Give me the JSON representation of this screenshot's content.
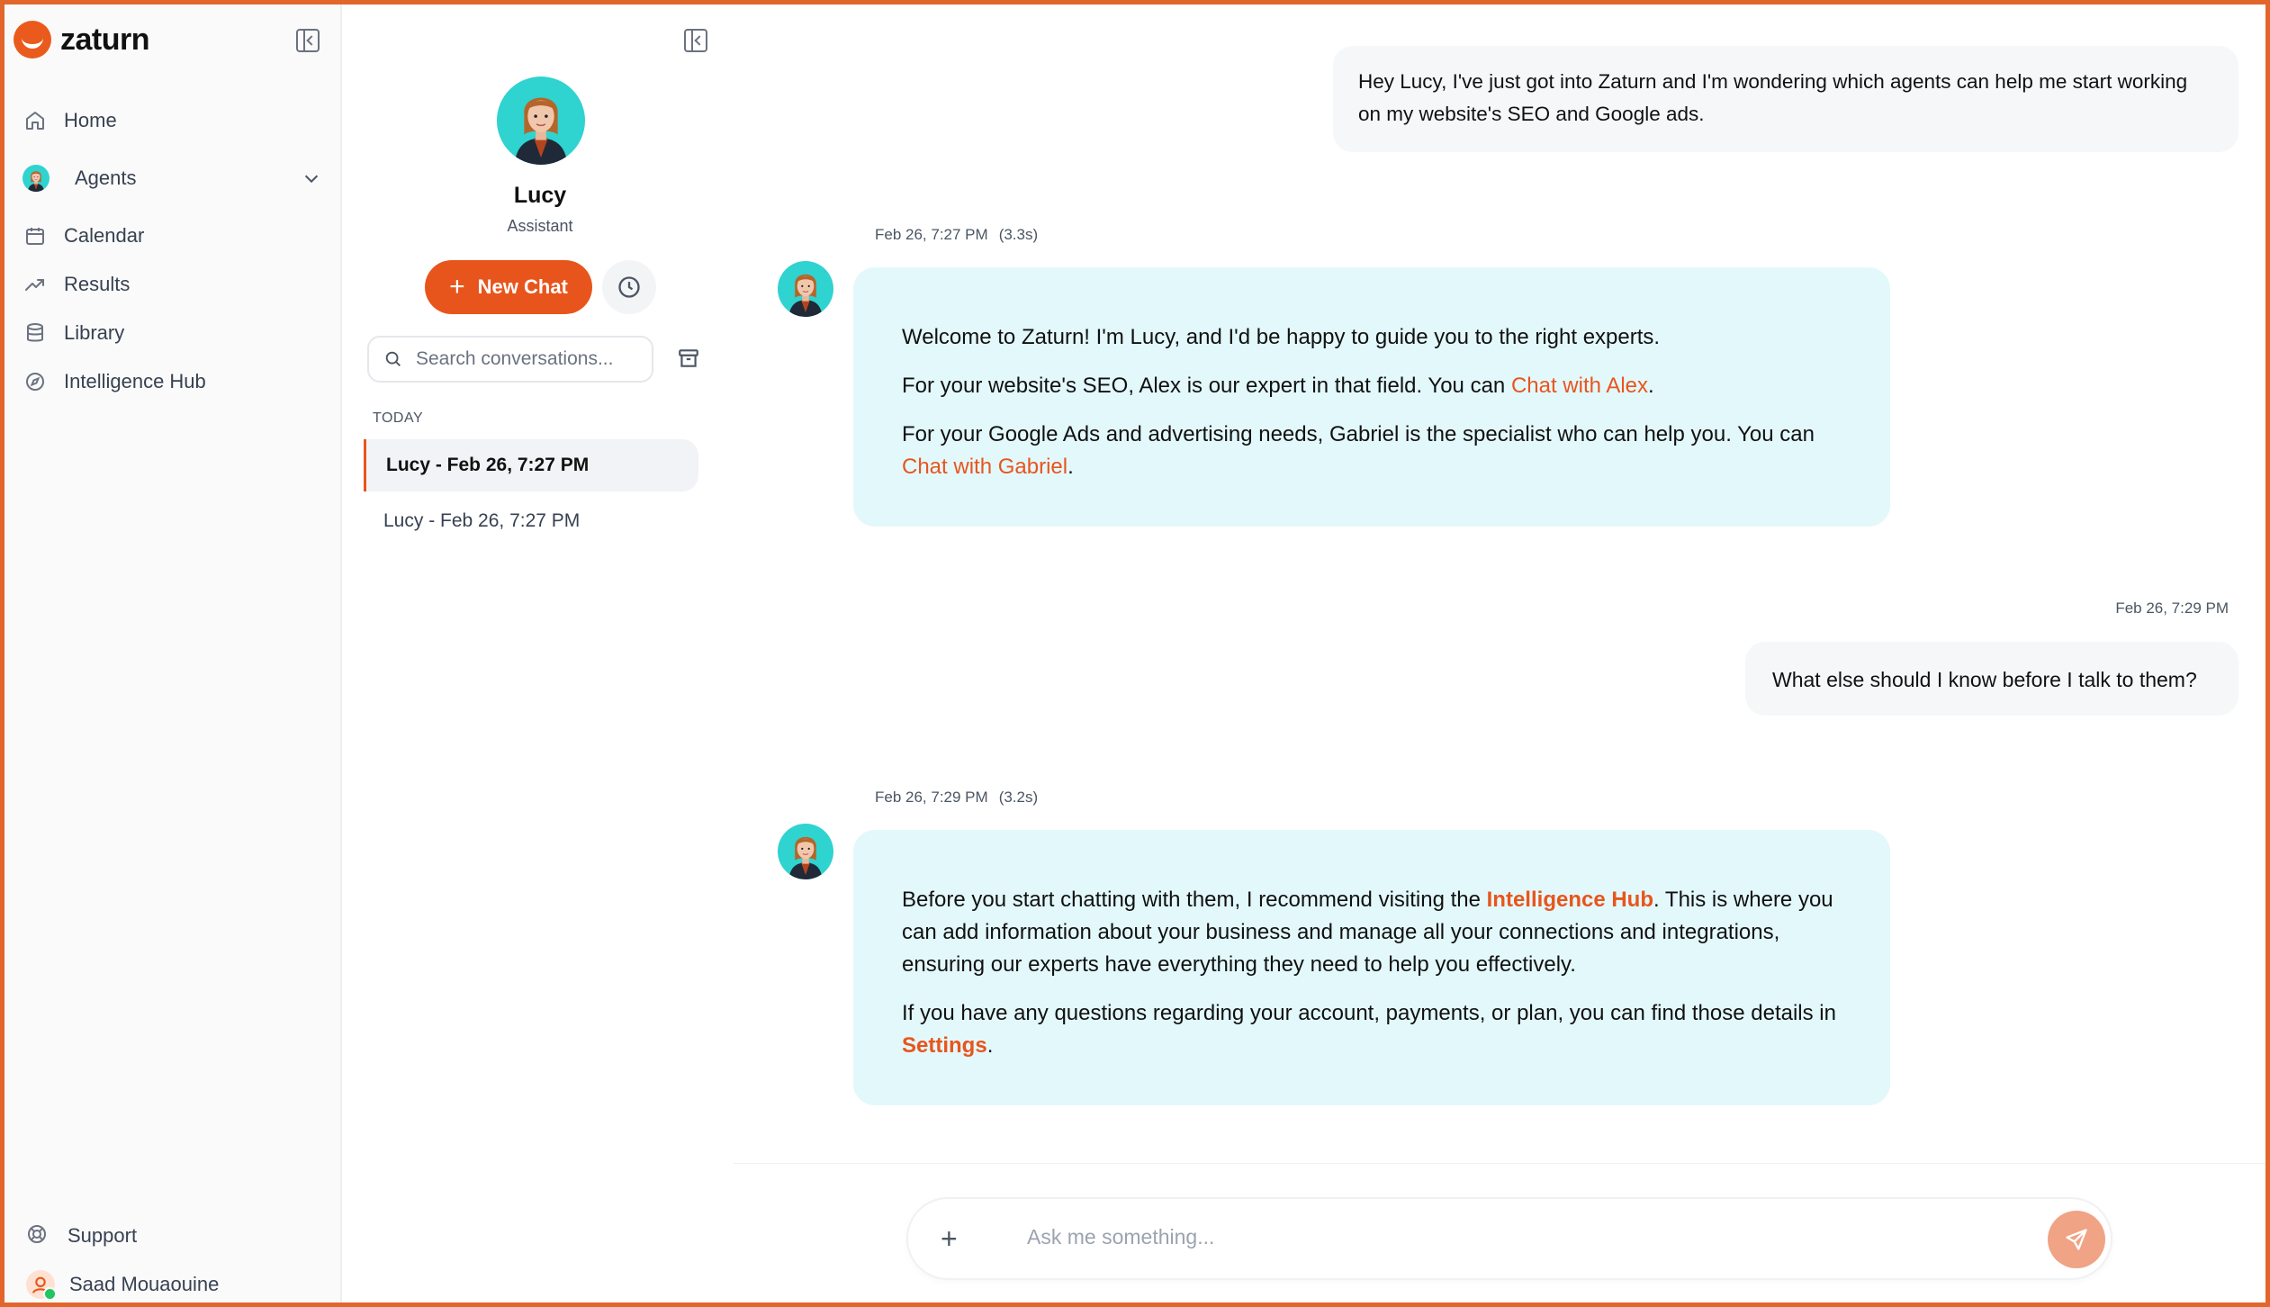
{
  "app": {
    "brand": "zaturn",
    "accent_color": "#e8551c"
  },
  "sidebar": {
    "items": [
      {
        "label": "Home",
        "icon": "home-icon"
      },
      {
        "label": "Agents",
        "icon": "agent-avatar"
      },
      {
        "label": "Calendar",
        "icon": "calendar-icon"
      },
      {
        "label": "Results",
        "icon": "trending-icon"
      },
      {
        "label": "Library",
        "icon": "database-icon"
      },
      {
        "label": "Intelligence Hub",
        "icon": "compass-icon"
      }
    ],
    "support": "Support",
    "user": "Saad Mouaouine"
  },
  "conversations": {
    "agent_name": "Lucy",
    "agent_role": "Assistant",
    "new_chat_label": "New Chat",
    "search_placeholder": "Search conversations...",
    "section": "TODAY",
    "items": [
      {
        "title": "Lucy - Feb 26, 7:27 PM",
        "active": true
      },
      {
        "title": "Lucy - Feb 26, 7:27 PM",
        "active": false
      }
    ]
  },
  "chat": {
    "messages": [
      {
        "role": "user",
        "text": "Hey Lucy, I've just got into Zaturn and I'm wondering which agents can help me start working on my website's SEO and Google ads."
      },
      {
        "role": "assistant",
        "time": "Feb 26, 7:27 PM",
        "duration": "(3.3s)",
        "p1": "Welcome to Zaturn! I'm Lucy, and I'd be happy to guide you to the right experts.",
        "p2_before": "For your website's SEO, Alex is our expert in that field. You can ",
        "p2_link": "Chat with Alex",
        "p2_after": ".",
        "p3_before": "For your Google Ads and advertising needs, Gabriel is the specialist who can help you. You can ",
        "p3_link": "Chat with Gabriel",
        "p3_after": "."
      },
      {
        "role": "user",
        "time": "Feb 26, 7:29 PM",
        "text": "What else should I know before I talk to them?"
      },
      {
        "role": "assistant",
        "time": "Feb 26, 7:29 PM",
        "duration": "(3.2s)",
        "p1_before": "Before you start chatting with them, I recommend visiting the ",
        "p1_link": "Intelligence Hub",
        "p1_after": ". This is where you can add information about your business and manage all your connections and integrations, ensuring our experts have everything they need to help you effectively.",
        "p2_before": "If you have any questions regarding your account, payments, or plan, you can find those details in ",
        "p2_link": "Settings",
        "p2_after": "."
      }
    ],
    "input_placeholder": "Ask me something..."
  }
}
